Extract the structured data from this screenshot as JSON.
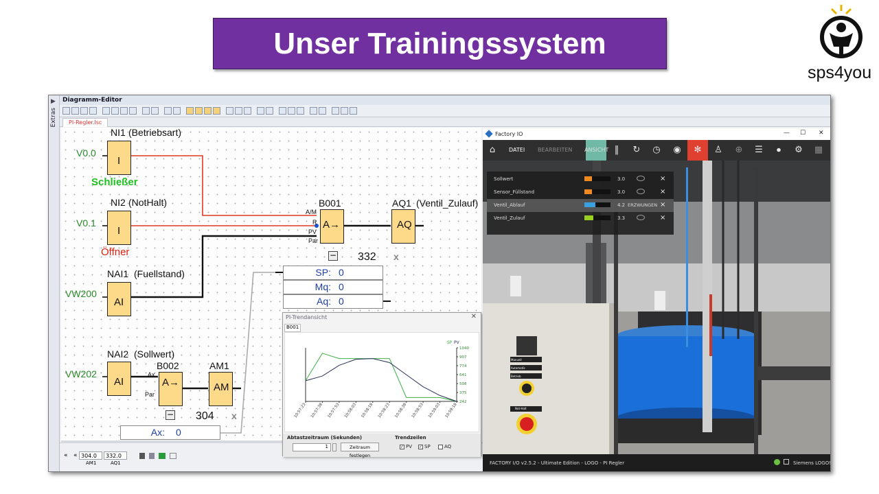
{
  "slide": {
    "title": "Unser Trainingssystem",
    "logo_text": "sps4you"
  },
  "editor": {
    "window_title": "Diagramm-Editor",
    "side_tab": "Extras",
    "file_tab": "PI-Regler.lsc",
    "blocks": {
      "ni1": {
        "name": "NI1",
        "desc": "(Betriebsart)",
        "input": "V0.0",
        "symbol": "I",
        "caption": "Schließer"
      },
      "ni2": {
        "name": "NI2",
        "desc": "(NotHalt)",
        "input": "V0.1",
        "symbol": "I",
        "caption": "Öffner"
      },
      "nai1": {
        "name": "NAI1",
        "desc": "(Fuellstand)",
        "input": "VW200",
        "symbol": "AI"
      },
      "nai2": {
        "name": "NAI2",
        "desc": "(Sollwert)",
        "input": "VW202",
        "symbol": "AI"
      },
      "b001": {
        "name": "B001",
        "symbol": "A→",
        "pins": [
          "A/M",
          "R",
          "PV",
          "Par"
        ]
      },
      "aq1": {
        "name": "AQ1",
        "desc": "(Ventil_Zulauf)",
        "symbol": "AQ"
      },
      "b002": {
        "name": "B002",
        "symbol": "A→",
        "pins": [
          "Ax",
          "Par"
        ]
      },
      "am1": {
        "name": "AM1",
        "symbol": "AM"
      }
    },
    "param_box_1": {
      "number": "332",
      "rows": [
        {
          "label": "SP:",
          "value": "0"
        },
        {
          "label": "Mq:",
          "value": "0"
        },
        {
          "label": "Aq:",
          "value": "0"
        }
      ]
    },
    "param_box_2": {
      "number": "304",
      "rows": [
        {
          "label": "Ax:",
          "value": "0"
        }
      ]
    },
    "collapse_glyph": "−",
    "close_glyph": "x",
    "status": {
      "nav_first": "«",
      "nav_prev": "«",
      "cells": [
        {
          "value": "304.0",
          "label": "AM1"
        },
        {
          "value": "332.0",
          "label": "AQ1"
        }
      ]
    }
  },
  "trend": {
    "title": "PI-Trendansicht",
    "close": "✕",
    "tab": "B001",
    "legend_sp": "SP",
    "legend_pv": "PV",
    "sample_label": "Abtastzeitraum (Sekunden)",
    "sample_value": "1",
    "set_button": "Zeitraum festlegen",
    "lines_label": "Trendzeilen",
    "checks": [
      {
        "label": "PV",
        "checked": true
      },
      {
        "label": "SP",
        "checked": true
      },
      {
        "label": "AQ",
        "checked": false
      }
    ]
  },
  "chart_data": {
    "type": "line",
    "x": [
      "10:57:23",
      "10:57:38",
      "10:57:53",
      "10:58:03",
      "10:58:18",
      "10:58:23",
      "10:58:38",
      "10:58:53",
      "10:59:03",
      "10:59:18"
    ],
    "y_ticks": [
      "1040",
      "907",
      "774",
      "641",
      "508",
      "375",
      "242"
    ],
    "ylim": [
      242,
      1040
    ],
    "series": [
      {
        "name": "SP",
        "color": "#3cb043",
        "values": [
          550,
          960,
          880,
          880,
          880,
          880,
          300,
          300,
          300,
          242
        ]
      },
      {
        "name": "PV",
        "color": "#2a2f5a",
        "values": [
          550,
          620,
          780,
          870,
          880,
          820,
          640,
          460,
          330,
          242
        ]
      }
    ]
  },
  "factory_io": {
    "window_title": "Factory IO",
    "window_controls": [
      "—",
      "☐",
      "✕"
    ],
    "menu": [
      "DATEI",
      "BEARBEITEN",
      "ANSICHT"
    ],
    "tags": [
      {
        "name": "Sollwert",
        "value": "3.0",
        "fill": 0.3,
        "color": "#f08a20",
        "forced": ""
      },
      {
        "name": "Sensor_Füllstand",
        "value": "3.0",
        "fill": 0.3,
        "color": "#f08a20",
        "forced": ""
      },
      {
        "name": "Ventil_Ablauf",
        "value": "4.2",
        "fill": 0.42,
        "color": "#3aa0e0",
        "forced": "ERZWUNGEN"
      },
      {
        "name": "Ventil_Zulauf",
        "value": "3.3",
        "fill": 0.33,
        "color": "#9bd020",
        "forced": ""
      }
    ],
    "panel_buttons": [
      "Manuell",
      "Automatik",
      "Betrieb"
    ],
    "estop_label": "Not-Halt",
    "status_left": "FACTORY I/O v2.5.2 - Ultimate Edition - LOGO - PI Regler",
    "status_right": "Siemens LOGO!"
  }
}
